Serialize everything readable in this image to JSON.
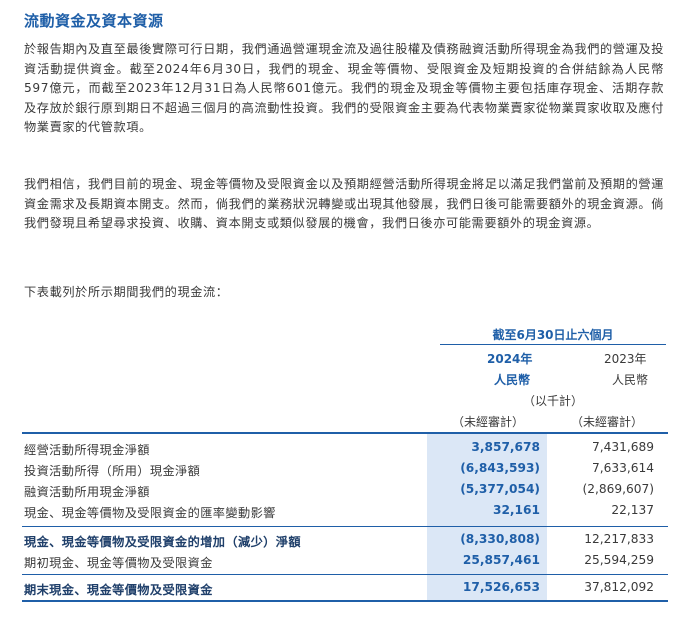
{
  "section_title": "流動資金及資本資源",
  "paragraphs": [
    "於報告期內及直至最後實際可行日期，我們通過營運現金流及過往股權及債務融資活動所得現金為我們的營運及投資活動提供資金。截至2024年6月30日，我們的現金、現金等價物、受限資金及短期投資的合併結餘為人民幣597億元，而截至2023年12月31日為人民幣601億元。我們的現金及現金等價物主要包括庫存現金、活期存款及存放於銀行原到期日不超過三個月的高流動性投資。我們的受限資金主要為代表物業賣家從物業買家收取及應付物業賣家的代管款項。",
    "我們相信，我們目前的現金、現金等價物及受限資金以及預期經營活動所得現金將足以滿足我們當前及預期的營運資金需求及長期資本開支。然而，倘我們的業務狀況轉變或出現其他發展，我們日後可能需要額外的現金資源。倘我們發現且希望尋求投資、收購、資本開支或類似發展的機會，我們日後亦可能需要額外的現金資源。",
    "下表載列於所示期間我們的現金流："
  ],
  "table": {
    "period_header": "截至6月30日止六個月",
    "col_2024": {
      "year": "2024年",
      "currency": "人民幣",
      "unit": "（以千計）",
      "audit": "（未經審計）"
    },
    "col_2023": {
      "year": "2023年",
      "currency": "人民幣",
      "audit": "（未經審計）"
    },
    "rows": [
      {
        "label": "經營活動所得現金淨額",
        "v2024": "3,857,678",
        "v2023": "7,431,689",
        "bold": false
      },
      {
        "label": "投資活動所得（所用）現金淨額",
        "v2024": "(6,843,593)",
        "v2023": "7,633,614",
        "bold": false
      },
      {
        "label": "融資活動所用現金淨額",
        "v2024": "(5,377,054)",
        "v2023": "(2,869,607)",
        "bold": false
      },
      {
        "label": "現金、現金等價物及受限資金的匯率變動影響",
        "v2024": "32,161",
        "v2023": "22,137",
        "bold": false
      },
      {
        "label": "現金、現金等價物及受限資金的增加（減少）淨額",
        "v2024": "(8,330,808)",
        "v2023": "12,217,833",
        "bold": true
      },
      {
        "label": "期初現金、現金等價物及受限資金",
        "v2024": "25,857,461",
        "v2023": "25,594,259",
        "bold": false
      },
      {
        "label": "期末現金、現金等價物及受限資金",
        "v2024": "17,526,653",
        "v2023": "37,812,092",
        "bold": true
      }
    ]
  }
}
